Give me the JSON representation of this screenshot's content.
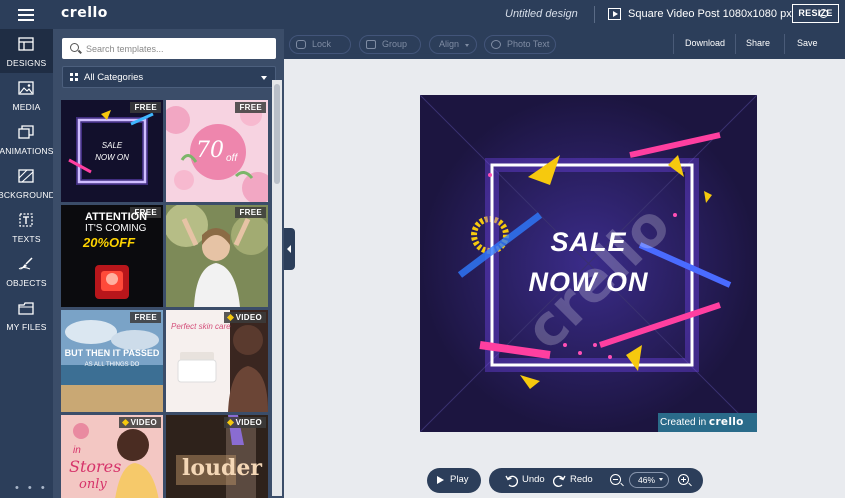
{
  "app": {
    "logo": "crello"
  },
  "header": {
    "doc_title": "Untitled design",
    "format": "Square Video Post 1080x1080 px",
    "resize": "RESIZE"
  },
  "rail": {
    "items": [
      {
        "label": "DESIGNS",
        "icon": "designs-icon"
      },
      {
        "label": "MEDIA",
        "icon": "media-icon"
      },
      {
        "label": "ANIMATIONS",
        "icon": "animations-icon"
      },
      {
        "label": "BCKGROUND",
        "icon": "background-icon"
      },
      {
        "label": "TEXTS",
        "icon": "texts-icon"
      },
      {
        "label": "OBJECTS",
        "icon": "objects-icon"
      },
      {
        "label": "MY FILES",
        "icon": "my-files-icon"
      }
    ],
    "more": "• • •"
  },
  "panel": {
    "search_placeholder": "Search templates...",
    "category": "All Categories",
    "templates": [
      {
        "badge": "FREE",
        "lines": [
          "SALE",
          "NOW ON"
        ]
      },
      {
        "badge": "FREE",
        "lines": [
          "70",
          "off"
        ]
      },
      {
        "badge": "FREE",
        "lines": [
          "ATTENTION",
          "IT'S COMING",
          "20%OFF"
        ]
      },
      {
        "badge": "FREE",
        "lines": []
      },
      {
        "badge": "FREE",
        "lines": [
          "BUT THEN IT PASSED",
          "AS ALL THINGS DO"
        ]
      },
      {
        "badge": "VIDEO",
        "lines": [
          "Perfect skin care"
        ]
      },
      {
        "badge": "VIDEO",
        "lines": [
          "in",
          "Stores",
          "only"
        ]
      },
      {
        "badge": "VIDEO",
        "lines": [
          "louder"
        ]
      }
    ]
  },
  "toolbar": {
    "lock": "Lock",
    "group": "Group",
    "align": "Align",
    "photo_text": "Photo Text",
    "download": "Download",
    "share": "Share",
    "save": "Save"
  },
  "canvas": {
    "headline_1": "SALE",
    "headline_2": "NOW ON",
    "watermark": "crello",
    "created_prefix": "Created in",
    "created_brand": "crello"
  },
  "controls": {
    "play": "Play",
    "undo": "Undo",
    "redo": "Redo",
    "zoom": "46%"
  }
}
